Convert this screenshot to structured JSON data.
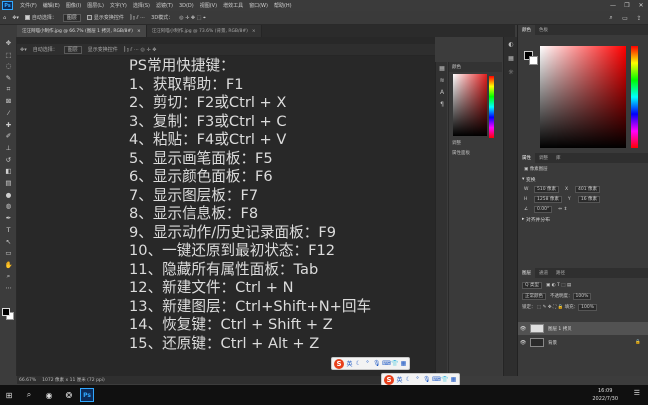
{
  "app": {
    "logo": "Ps",
    "menu": [
      "文件(F)",
      "编辑(E)",
      "图像(I)",
      "图层(L)",
      "文字(Y)",
      "选择(S)",
      "滤镜(T)",
      "3D(D)",
      "视图(V)",
      "增效工具",
      "窗口(W)",
      "帮助(H)"
    ],
    "window_controls": [
      "—",
      "❐",
      "✕"
    ]
  },
  "options_bar": {
    "auto_select_label": "自动选择：",
    "auto_select_value": "图层",
    "show_transform_label": "显示变换控件",
    "mode_3d_label": "3D模式："
  },
  "tabs": [
    {
      "label": "汪汪阿喵小制作.jpg @ 66.7% (图层 1 拷贝, RGB/8#)",
      "close": "×",
      "active": true
    },
    {
      "label": "汪汪阿喵小制作.jpg @ 73.6% (背景, RGB/8#)",
      "close": "×",
      "active": false
    }
  ],
  "inner_options": {
    "auto_select_label": "自动选择：",
    "auto_select_value": "图层",
    "show_transform_label": "显示变换控件"
  },
  "document_lines": [
    "PS常用快捷键：",
    "1、获取帮助：F1",
    "2、剪切：F2或Ctrl + X",
    "3、复制：F3或Ctrl + C",
    "4、粘贴：F4或Ctrl + V",
    "5、显示画笔面板：F5",
    "6、显示颜色面板：F6",
    "7、显示图层板：F7",
    "8、显示信息板：F8",
    "9、显示动作/历史记录面板：F9",
    "10、一键还原到最初状态：F12",
    "11、隐藏所有属性面板：Tab",
    "12、新建文件：Ctrl + N",
    "13、新建图层：Ctrl+Shift+N+回车",
    "14、恢复键：Ctrl + Shift + Z",
    "15、还原键：Ctrl + Alt + Z"
  ],
  "status_bar": {
    "zoom": "66.67%",
    "doc_size": "1072 像素 x 11 厘米 (72 ppi)"
  },
  "floating_panel": {
    "header": "颜色",
    "section": "调整",
    "footer": "属性面板"
  },
  "right_panel": {
    "color_tabs": [
      "颜色",
      "色板"
    ],
    "props_tabs": [
      "属性",
      "调整",
      "库"
    ],
    "props_kind": "像素图层",
    "transform_title": "变换",
    "w_label": "W",
    "w_value": "510 像素",
    "h_label": "H",
    "h_value": "1258 像素",
    "x_value": "401 像素",
    "y_value": "16 像素",
    "angle_value": "0.00°",
    "align_title": "对齐并分布",
    "layers_tabs": [
      "图层",
      "通道",
      "路径"
    ],
    "layers_filter": "Q 类型",
    "blend_mode": "正常颜色",
    "opacity_label": "不透明度：",
    "opacity_value": "100%",
    "fill_label": "填充：",
    "fill_value": "100%",
    "lock_label": "锁定：",
    "layers": [
      {
        "name": "图层 1 拷贝",
        "selected": true
      },
      {
        "name": "背景",
        "selected": false
      }
    ]
  },
  "taskbar": {
    "time": "16:09",
    "date": "2022/7/30",
    "ps_label": "Ps"
  }
}
